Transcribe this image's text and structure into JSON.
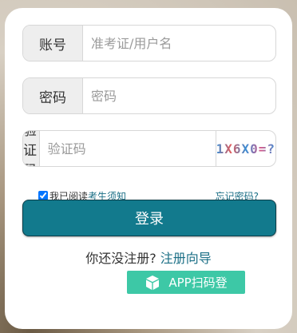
{
  "form": {
    "account_label": "账号",
    "account_placeholder": "准考证/用户名",
    "password_label": "密码",
    "password_placeholder": "密码",
    "captcha_label": "验证码",
    "captcha_placeholder": "验证码",
    "captcha_text": "1X6X0=?"
  },
  "options": {
    "agree_prefix": "我已阅读",
    "agree_link": "考生须知",
    "forgot_password": "忘记密码?"
  },
  "actions": {
    "login": "登录",
    "register_prompt": "你还没注册?",
    "register_link": "注册向导",
    "app_scan_login": "APP扫码登"
  }
}
